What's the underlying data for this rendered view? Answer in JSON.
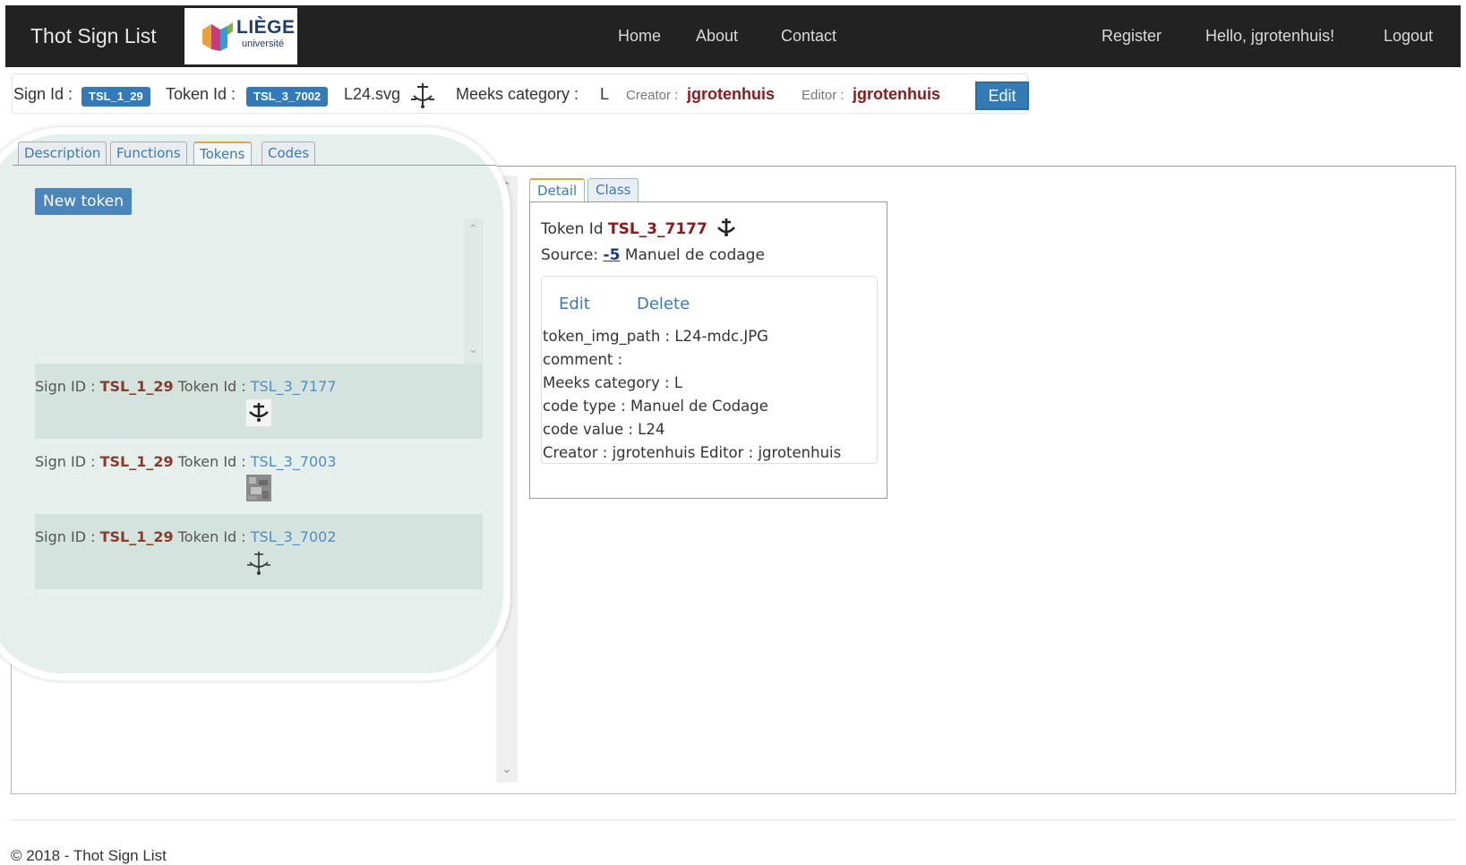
{
  "navbar": {
    "brand": "Thot Sign List",
    "logo_word": "LIÈGE",
    "logo_sub": "université",
    "links": {
      "home": "Home",
      "about": "About",
      "contact": "Contact"
    },
    "register": "Register",
    "greeting": "Hello, jgrotenhuis!",
    "logout": "Logout"
  },
  "signbar": {
    "sign_id_label": "Sign Id :",
    "sign_id": "TSL_1_29",
    "token_id_label": "Token Id :",
    "token_id": "TSL_3_7002",
    "file": "L24.svg",
    "meeks_label": "Meeks category :",
    "meeks_value": "L",
    "creator_label": "Creator :",
    "creator": "jgrotenhuis",
    "editor_label": "Editor :",
    "editor": "jgrotenhuis",
    "edit_button": "Edit"
  },
  "tabs": [
    "Description",
    "Functions",
    "Tokens",
    "Codes"
  ],
  "tokens_panel": {
    "new_token_button": "New token",
    "rows": [
      {
        "sign_label": "Sign ID :",
        "sign_id": "TSL_1_29",
        "token_label": "Token Id :",
        "token_id": "TSL_3_7177"
      },
      {
        "sign_label": "Sign ID :",
        "sign_id": "TSL_1_29",
        "token_label": "Token Id :",
        "token_id": "TSL_3_7003"
      },
      {
        "sign_label": "Sign ID :",
        "sign_id": "TSL_1_29",
        "token_label": "Token Id :",
        "token_id": "TSL_3_7002"
      }
    ]
  },
  "detail": {
    "tabs": [
      "Detail",
      "Class"
    ],
    "token_label": "Token Id",
    "token_id": "TSL_3_7177",
    "source_label": "Source:",
    "source_link": "-5",
    "source_text": "Manuel de codage",
    "edit": "Edit",
    "delete": "Delete",
    "fields": [
      "token_img_path : L24-mdc.JPG",
      "comment :",
      "Meeks category :  L",
      "code type : Manuel de Codage",
      "code value : L24",
      "Creator : jgrotenhuis Editor : jgrotenhuis"
    ]
  },
  "footer": "© 2018 - Thot Sign List",
  "colors": {
    "navbar": "#222222",
    "accent": "#337ab7",
    "highlight": "#e5efec",
    "id_red": "#8b1a1a"
  }
}
